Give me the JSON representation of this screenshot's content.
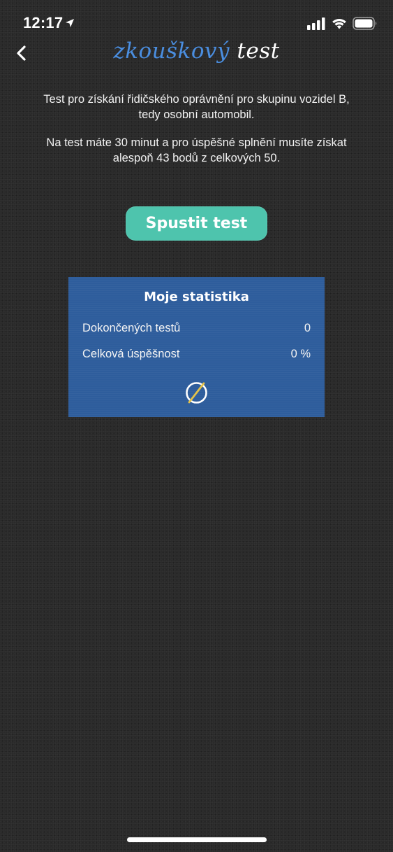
{
  "status_bar": {
    "time": "12:17",
    "icons": [
      "location-arrow-icon",
      "cellular-signal-icon",
      "wifi-icon",
      "battery-icon"
    ]
  },
  "nav": {
    "back_icon": "chevron-left-icon",
    "title_part1": "zkouškový",
    "title_part2": "test",
    "title_colors": {
      "part1": "#4a8ee0",
      "part2": "#ffffff"
    }
  },
  "intro": {
    "paragraph1_line1": "Test  pro získání řidičského oprávnění pro skupinu vozidel B,",
    "paragraph1_line2": "tedy osobní automobil.",
    "paragraph2_line1": "Na test máte 30 minut a pro úspěšné splnění musíte získat",
    "paragraph2_line2": "alespoň 43 bodů z celkových 50."
  },
  "start_button": {
    "label": "Spustit test",
    "color": "#4ec4ad"
  },
  "stats": {
    "title": "Moje statistika",
    "background": "#2e5d9c",
    "rows": [
      {
        "label": "Dokončených testů",
        "value": "0"
      },
      {
        "label": "Celková úspěšnost",
        "value": "0 %"
      }
    ],
    "reset_icon": "empty-set-icon",
    "reset_icon_accent": "#e3c24a"
  }
}
